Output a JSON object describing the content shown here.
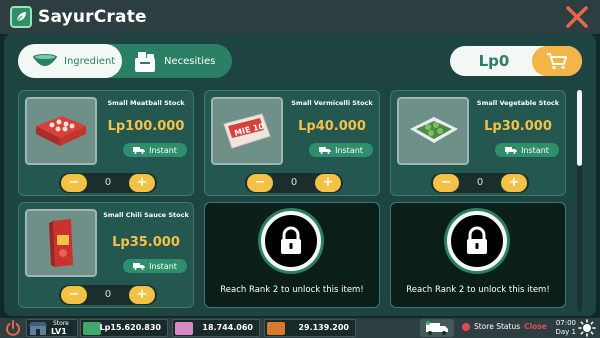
{
  "app": {
    "title": "SayurCrate"
  },
  "tabs": [
    {
      "label": "Ingredient",
      "icon": "bowl-icon"
    },
    {
      "label": "Necesities",
      "icon": "necessities-icon"
    }
  ],
  "cart": {
    "total": "Lp0",
    "icon": "cart-icon"
  },
  "items": [
    {
      "name": "Small Meatball Stock",
      "price": "Lp100.000",
      "delivery": "Instant",
      "qty": "0"
    },
    {
      "name": "Small Vermicelli Stock",
      "price": "Lp40.000",
      "delivery": "Instant",
      "qty": "0",
      "package_text": "MIE 10"
    },
    {
      "name": "Small Vegetable Stock",
      "price": "Lp30.000",
      "delivery": "Instant",
      "qty": "0"
    },
    {
      "name": "Small Chili Sauce Stock",
      "price": "Lp35.000",
      "delivery": "Instant",
      "qty": "0"
    },
    {
      "name": "",
      "price": "",
      "locked_text": "Reach Rank 2 to unlock this item!"
    },
    {
      "name": "",
      "price": "",
      "locked_text": "Reach Rank 2 to unlock this item!"
    }
  ],
  "qty_controls": {
    "minus": "−",
    "plus": "+"
  },
  "footer": {
    "store_label": "Store",
    "store_level": "LV1",
    "money": "Lp15.620.830",
    "stat2": "18.744.060",
    "stat3": "29.139.200",
    "store_status_label": "Store Status",
    "store_status_value": "Close",
    "time": "07:00",
    "day": "Day 1"
  },
  "colors": {
    "accent_green": "#2a7f64",
    "price_gold": "#f4c247",
    "cart_orange": "#f4b548",
    "close_red": "#e24b55"
  }
}
